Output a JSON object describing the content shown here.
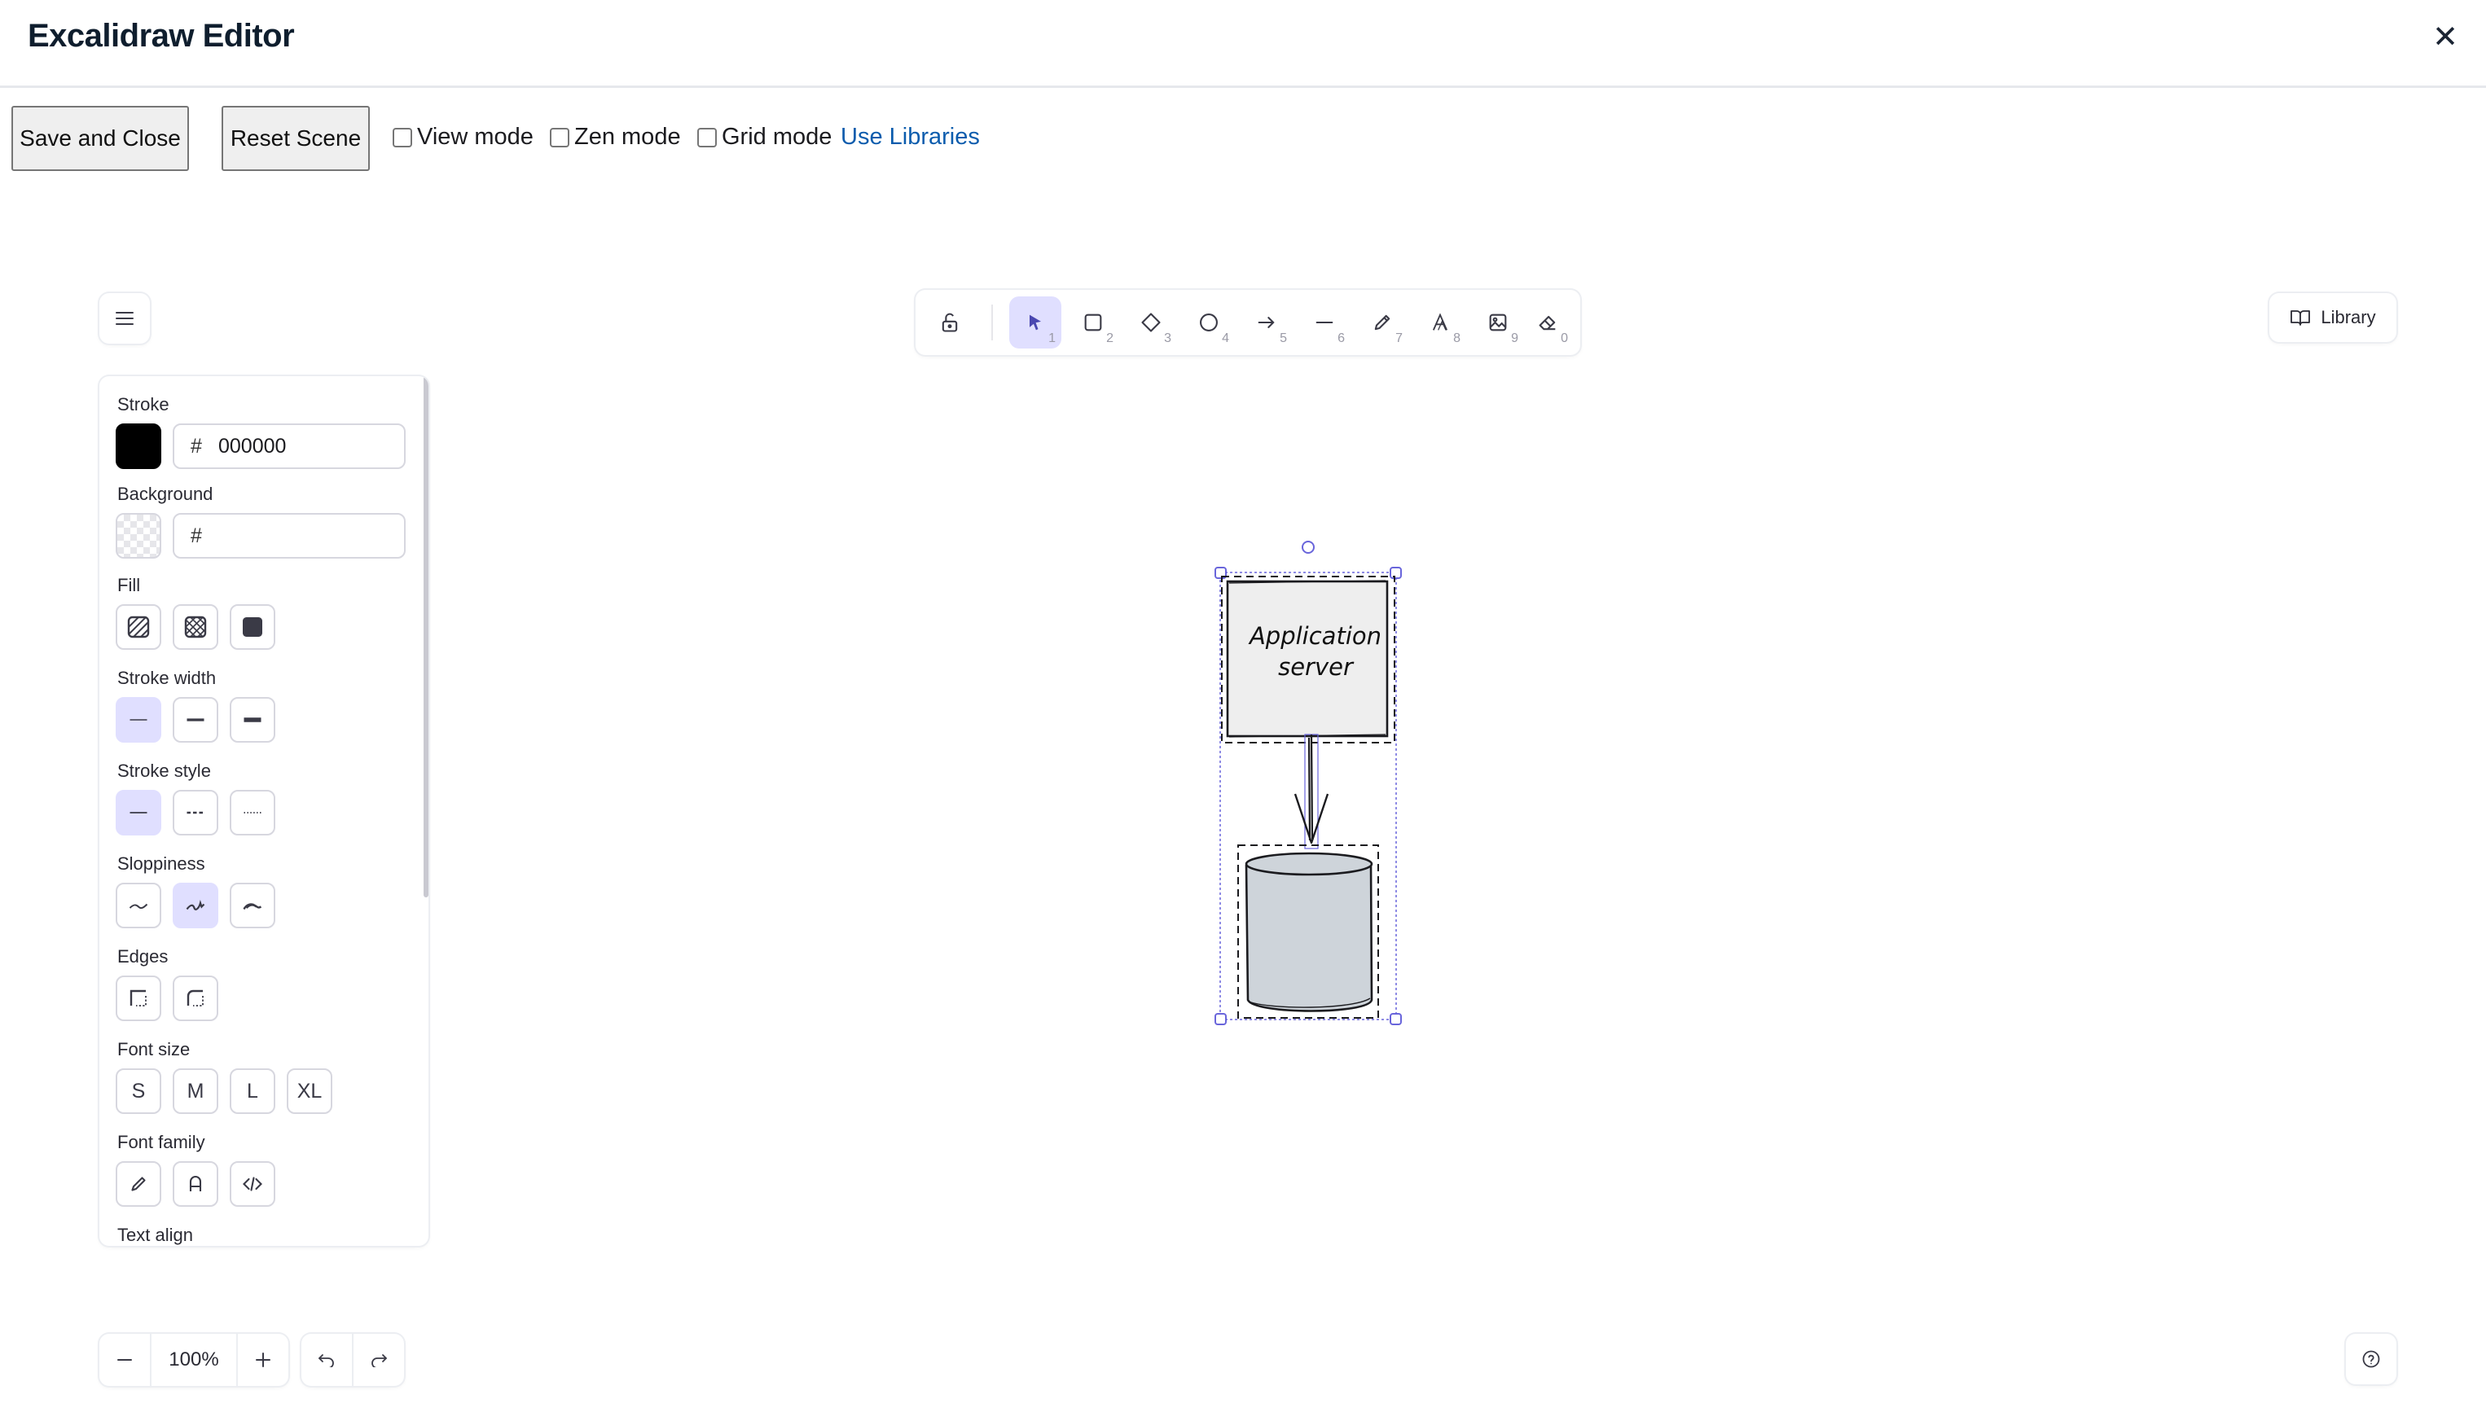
{
  "header": {
    "title": "Excalidraw Editor",
    "close_icon": "close-icon"
  },
  "actions": {
    "save_label": "Save and Close",
    "reset_label": "Reset Scene",
    "view_mode_label": "View mode",
    "zen_mode_label": "Zen mode",
    "grid_mode_label": "Grid mode",
    "view_mode_checked": false,
    "zen_mode_checked": false,
    "grid_mode_checked": false,
    "libraries_link": "Use Libraries"
  },
  "toolbar": {
    "tools": [
      {
        "name": "lock-icon",
        "key": ""
      },
      {
        "name": "selection-icon",
        "key": "1"
      },
      {
        "name": "rectangle-icon",
        "key": "2"
      },
      {
        "name": "diamond-icon",
        "key": "3"
      },
      {
        "name": "ellipse-icon",
        "key": "4"
      },
      {
        "name": "arrow-icon",
        "key": "5"
      },
      {
        "name": "line-icon",
        "key": "6"
      },
      {
        "name": "pencil-icon",
        "key": "7"
      },
      {
        "name": "text-icon",
        "key": "8"
      },
      {
        "name": "image-icon",
        "key": "9"
      },
      {
        "name": "eraser-icon",
        "key": "0"
      }
    ],
    "active_tool": "selection-icon"
  },
  "library": {
    "label": "Library"
  },
  "panel": {
    "stroke": {
      "label": "Stroke",
      "hex": "000000",
      "color": "#000000"
    },
    "background": {
      "label": "Background",
      "hex": ""
    },
    "fill": {
      "label": "Fill"
    },
    "stroke_width": {
      "label": "Stroke width"
    },
    "stroke_style": {
      "label": "Stroke style"
    },
    "sloppiness": {
      "label": "Sloppiness"
    },
    "edges": {
      "label": "Edges"
    },
    "font_size": {
      "label": "Font size",
      "options": [
        "S",
        "M",
        "L",
        "XL"
      ]
    },
    "font_family": {
      "label": "Font family"
    },
    "text_align": {
      "label": "Text align"
    },
    "hash": "#"
  },
  "canvas": {
    "app_label": "Application server",
    "cylinder_fill": "#ced4da",
    "box_fill": "#eeeeee",
    "selection_color": "#6965db"
  },
  "footer": {
    "zoom": "100%"
  },
  "colors": {
    "accent": "#6965db",
    "accent_light": "#e0dfff",
    "link": "#0b5cad"
  }
}
